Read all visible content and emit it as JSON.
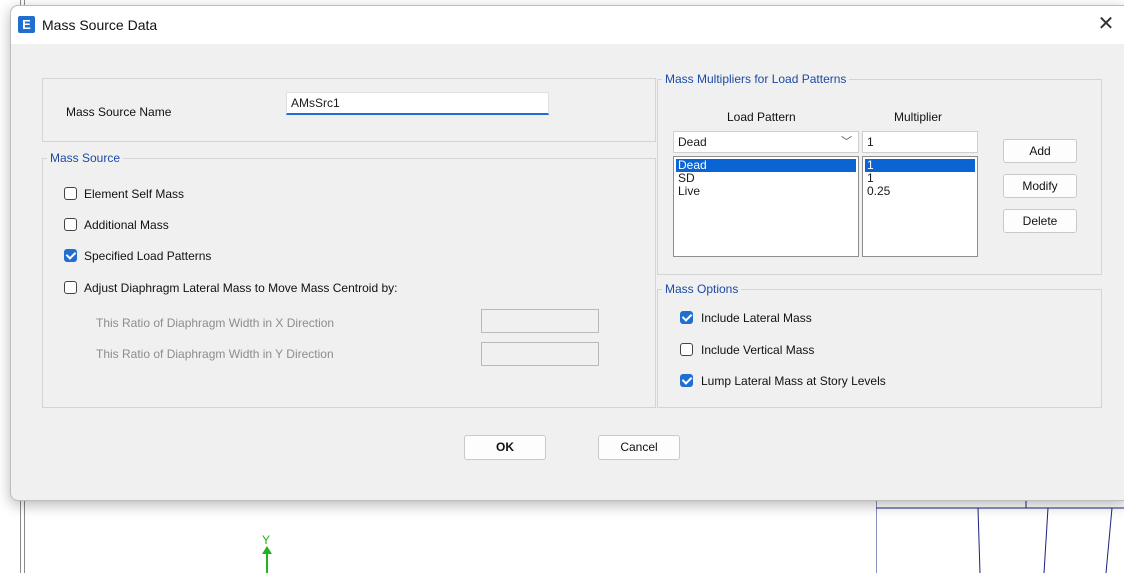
{
  "dialog": {
    "title": "Mass Source Data",
    "close_glyph": "✕"
  },
  "icon": {
    "app_icon_letter": "E"
  },
  "name_section": {
    "label": "Mass Source Name",
    "value": "AMsSrc1"
  },
  "mass_source": {
    "title": "Mass Source",
    "element_self_mass": {
      "label": "Element Self Mass",
      "checked": false
    },
    "additional_mass": {
      "label": "Additional Mass",
      "checked": false
    },
    "specified_load_patterns": {
      "label": "Specified Load Patterns",
      "checked": true
    },
    "adjust_diaphragm": {
      "label": "Adjust Diaphragm Lateral Mass to Move Mass Centroid by:",
      "checked": false
    },
    "ratio_x_label": "This Ratio of Diaphragm Width in X Direction",
    "ratio_y_label": "This Ratio of Diaphragm Width in Y Direction"
  },
  "multipliers": {
    "title": "Mass Multipliers for Load Patterns",
    "col_load_pattern": "Load Pattern",
    "col_multiplier": "Multiplier",
    "selected_pattern": "Dead",
    "multiplier_value": "1",
    "rows": [
      {
        "pattern": "Dead",
        "multiplier": "1",
        "selected": true
      },
      {
        "pattern": "SD",
        "multiplier": "1",
        "selected": false
      },
      {
        "pattern": "Live",
        "multiplier": "0.25",
        "selected": false
      }
    ],
    "add_label": "Add",
    "modify_label": "Modify",
    "delete_label": "Delete"
  },
  "mass_options": {
    "title": "Mass Options",
    "include_lateral": {
      "label": "Include Lateral Mass",
      "checked": true
    },
    "include_vertical": {
      "label": "Include Vertical Mass",
      "checked": false
    },
    "lump_lateral": {
      "label": "Lump Lateral Mass at Story Levels",
      "checked": true
    }
  },
  "footer": {
    "ok_label": "OK",
    "cancel_label": "Cancel"
  },
  "background": {
    "axis_label": "Y"
  },
  "colors": {
    "accent": "#1f6fd1",
    "group_title": "#1c4aa6",
    "selection": "#0a64d3",
    "axis": "#1db41d"
  }
}
